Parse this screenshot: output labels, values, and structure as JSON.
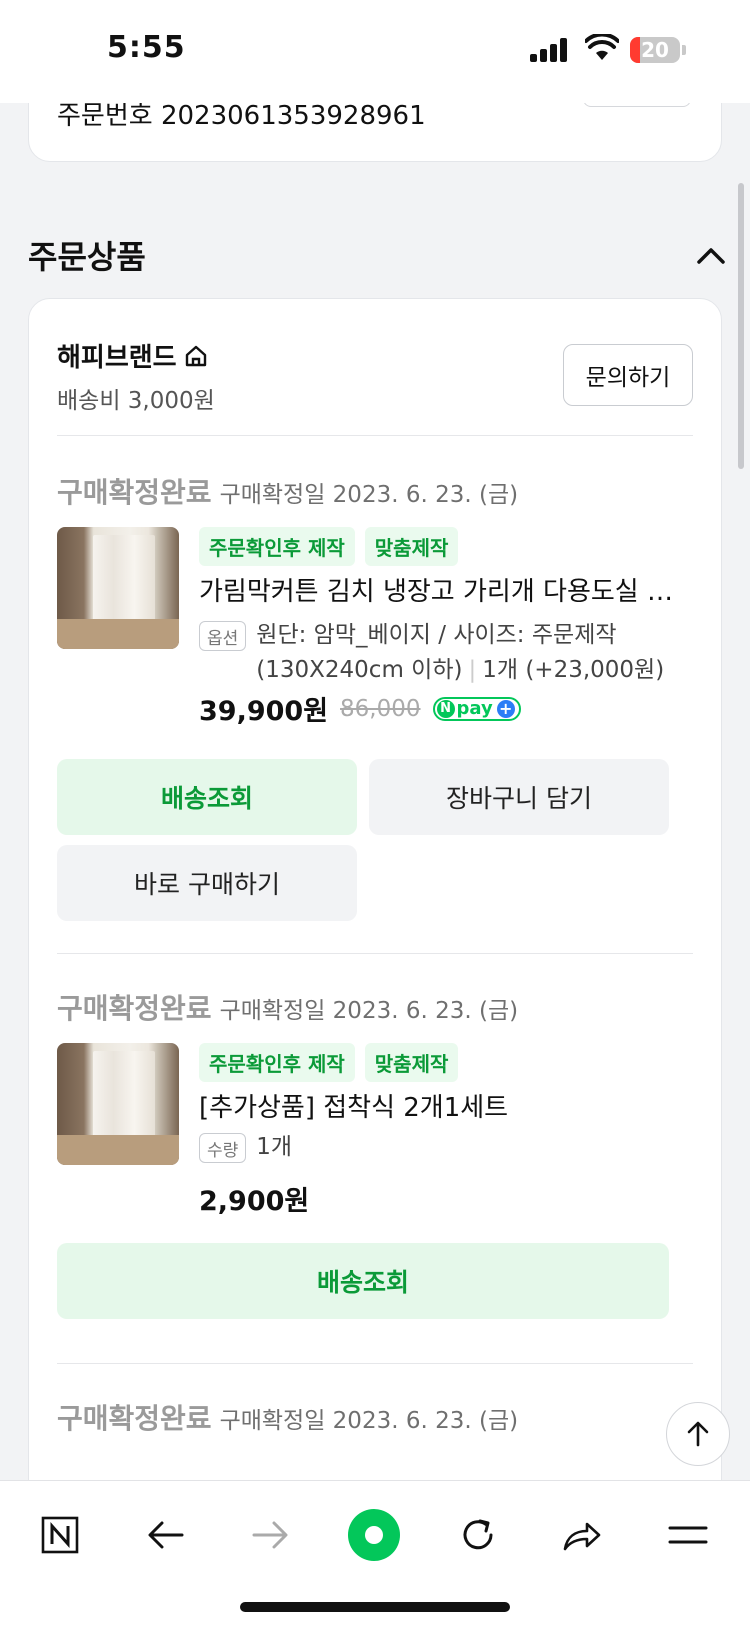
{
  "status_bar": {
    "time": "5:55",
    "battery": "20",
    "battery_level_percent": 20
  },
  "order": {
    "order_number_text": "주문번호 2023061353928961"
  },
  "section": {
    "title": "주문상품"
  },
  "seller": {
    "name": "해피브랜드",
    "shipping_fee": "배송비 3,000원",
    "inquiry_button": "문의하기"
  },
  "items": [
    {
      "status": "구매확정완료",
      "date": "구매확정일 2023. 6. 23. (금)",
      "badges": [
        "주문확인후 제작",
        "맞춤제작"
      ],
      "title": "가림막커튼 김치 냉장고 가리개 다용도실 베란다 커튼",
      "option_tag": "옵션",
      "option_text": "원단: 암막_베이지 / 사이즈: 주문제작 (130X240cm 이하)",
      "quantity": "1개 (+23,000원)",
      "price": "39,900원",
      "original_price": "86,000",
      "npay_label": "pay",
      "buttons": {
        "track": "배송조회",
        "cart": "장바구니 담기",
        "buy_now": "바로 구매하기"
      }
    },
    {
      "status": "구매확정완료",
      "date": "구매확정일 2023. 6. 23. (금)",
      "badges": [
        "주문확인후 제작",
        "맞춤제작"
      ],
      "title": "[추가상품] 접착식 2개1세트",
      "option_tag": "수량",
      "option_text": "1개",
      "price": "2,900원",
      "buttons": {
        "track": "배송조회"
      }
    },
    {
      "status": "구매확정완료",
      "date": "구매확정일 2023. 6. 23. (금)"
    }
  ],
  "toolbar": {
    "icons": [
      "naver-home-icon",
      "back-arrow-icon",
      "forward-arrow-icon",
      "green-dot-icon",
      "refresh-icon",
      "share-icon",
      "menu-icon"
    ]
  }
}
